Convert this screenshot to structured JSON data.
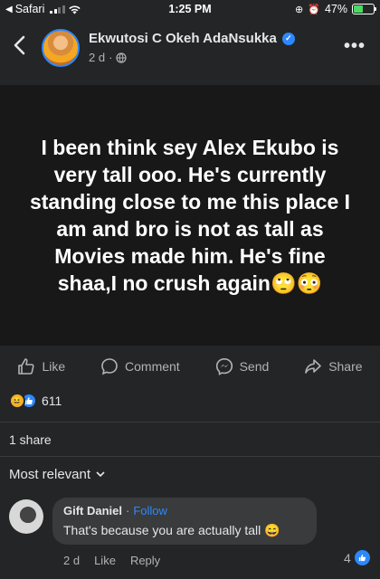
{
  "status_bar": {
    "back_app": "Safari",
    "time": "1:25 PM",
    "battery": "47%",
    "battery_level": 0.47
  },
  "header": {
    "page_name": "Ekwutosi C Okeh AdaNsukka",
    "time_ago": "2 d",
    "privacy_icon": "globe-icon"
  },
  "post": {
    "text": "I been think sey Alex Ekubo is very tall ooo. He's currently standing close to me this place I am and bro is not as tall as Movies made him. He's fine shaa,I no crush again🙄😳"
  },
  "actions": {
    "like": "Like",
    "comment": "Comment",
    "send": "Send",
    "share": "Share"
  },
  "reactions": {
    "count": "611",
    "types": [
      "haha",
      "like"
    ]
  },
  "shares": "1 share",
  "sort_label": "Most relevant",
  "comments": [
    {
      "author": "Gift Daniel",
      "follow_label": "Follow",
      "text": "That's because you are actually tall 😄",
      "time": "2 d",
      "like_label": "Like",
      "reply_label": "Reply",
      "reaction_count": "4"
    }
  ],
  "colors": {
    "background": "#242526",
    "post_background": "#181818",
    "accent": "#2d88ff",
    "muted_text": "#b0b3b8"
  }
}
